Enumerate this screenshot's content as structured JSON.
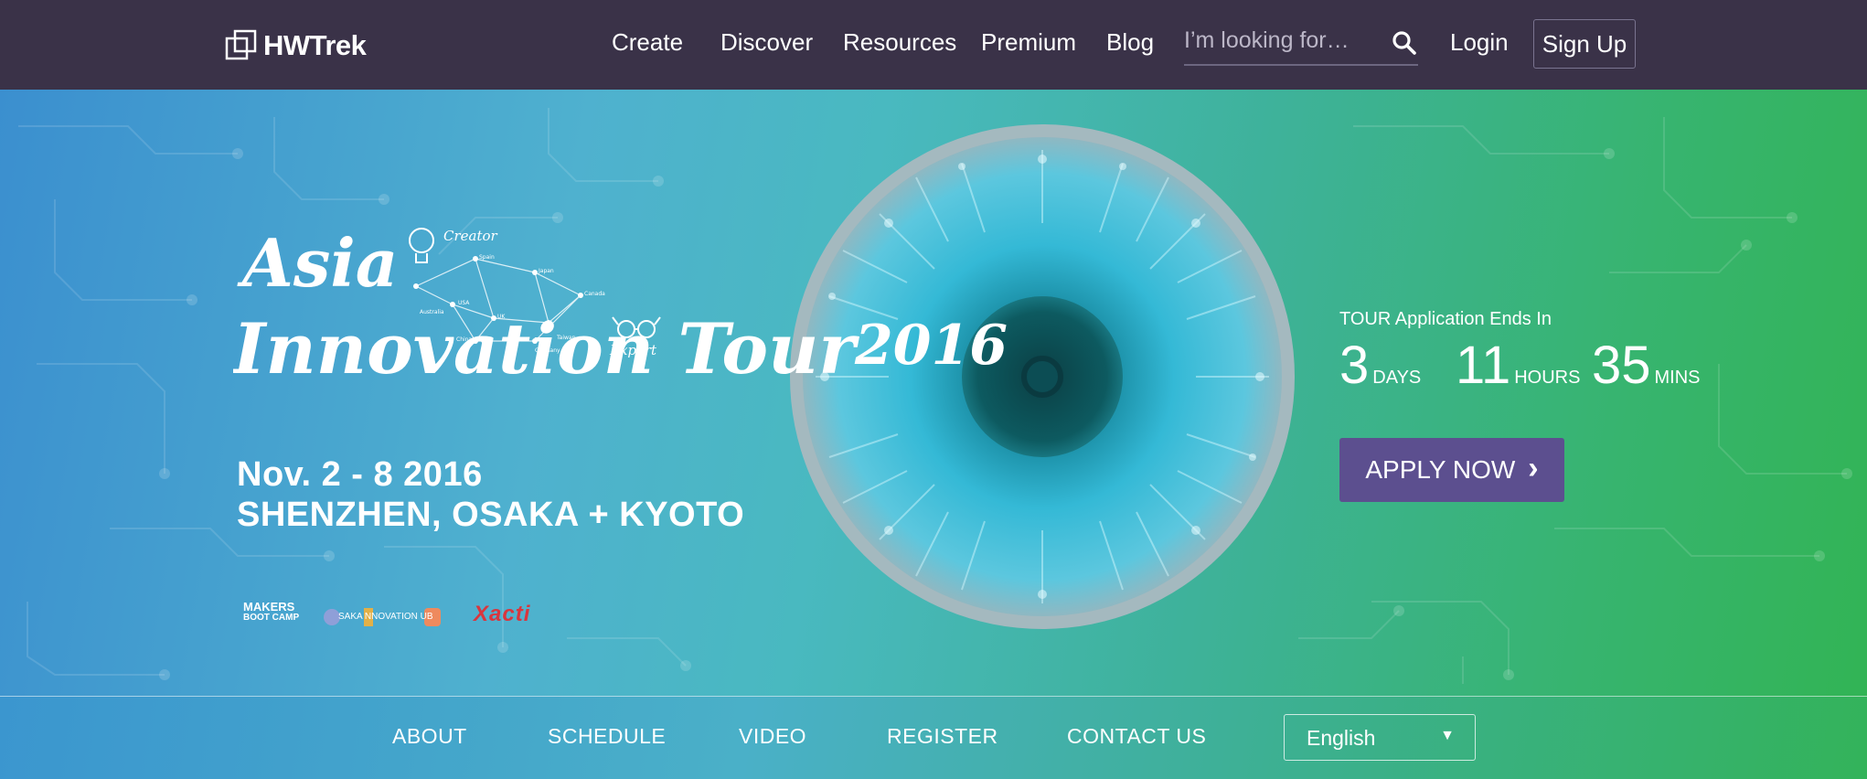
{
  "brand": {
    "name": "HWTrek"
  },
  "nav": {
    "items": [
      "Create",
      "Discover",
      "Resources",
      "Premium",
      "Blog"
    ],
    "search_placeholder": "I’m looking for…",
    "login": "Login",
    "signup": "Sign Up"
  },
  "hero": {
    "title_line1": "Asia",
    "title_line2": "Innovation Tour",
    "title_year": "2016",
    "map_labels": {
      "creator": "Creator",
      "expert": "Expert",
      "places": [
        "Spain",
        "USA",
        "Japan",
        "Australia",
        "UK",
        "Canada",
        "China",
        "Germany",
        "Taiwan"
      ]
    },
    "dates": "Nov. 2 - 8  2016",
    "cities": "SHENZHEN, OSAKA + KYOTO",
    "sponsors": {
      "makers_line1": "MAKERS",
      "makers_line2": "BOOT CAMP",
      "osaka": "SAKA NNOVATION UB",
      "xacti": "Xacti"
    },
    "countdown": {
      "label": "TOUR Application Ends In",
      "days": "3",
      "days_unit": "DAYS",
      "hours": "11",
      "hours_unit": "HOURS",
      "mins": "35",
      "mins_unit": "MINS"
    },
    "apply_label": "APPLY NOW",
    "apply_chevron": "›"
  },
  "subnav": {
    "items": [
      "ABOUT",
      "SCHEDULE",
      "VIDEO",
      "REGISTER",
      "CONTACT US"
    ],
    "language": "English",
    "language_arrow": "▼"
  },
  "icons": {
    "logo": "hwtrek-logo-icon",
    "search": "search-icon",
    "chevron": "chevron-right-icon",
    "dropdown": "chevron-down-icon",
    "eye": "eye-illustration",
    "lightbulb": "lightbulb-icon",
    "glasses": "glasses-icon"
  },
  "colors": {
    "topbar": "#3a3248",
    "apply_button": "#5c4f8f",
    "xacti_red": "#d9363e",
    "gradient_start": "#3b8fcf",
    "gradient_end": "#32b455"
  }
}
